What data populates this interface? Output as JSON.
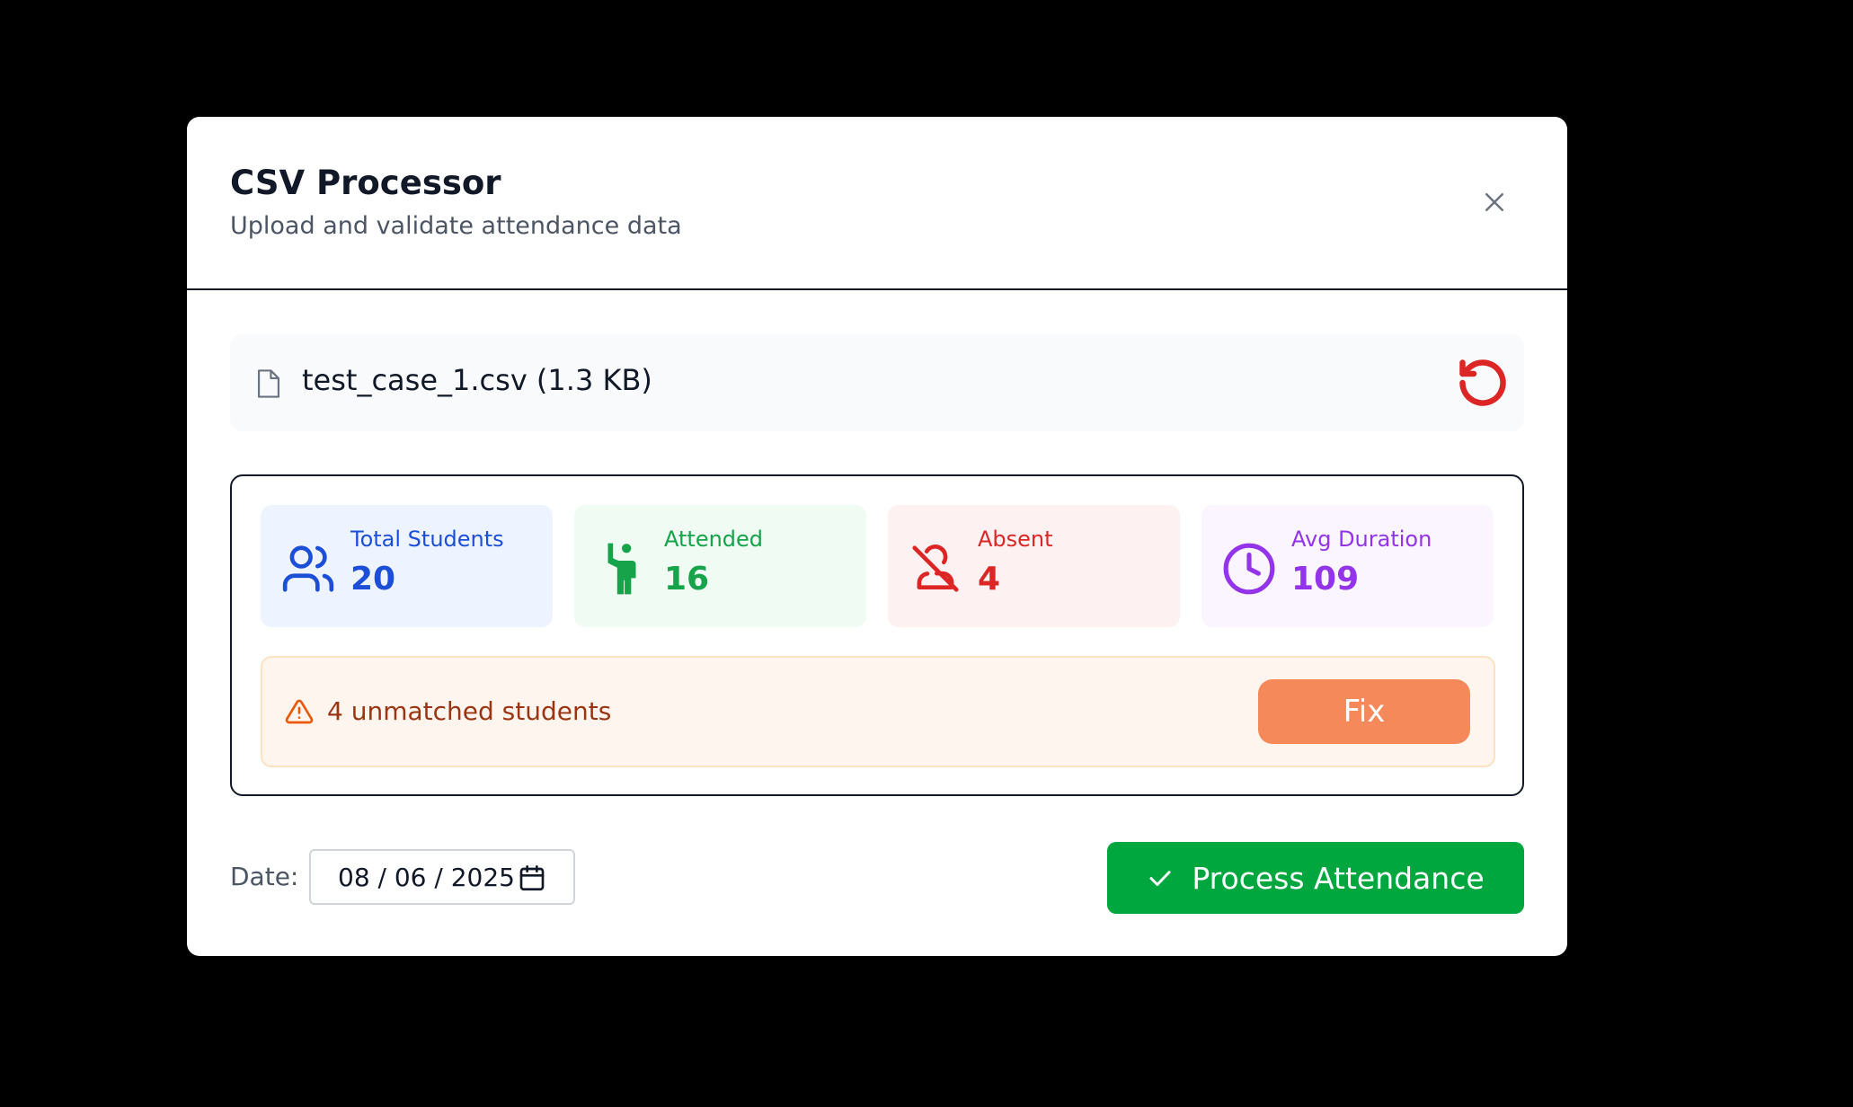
{
  "header": {
    "title": "CSV Processor",
    "subtitle": "Upload and validate attendance data"
  },
  "file": {
    "name": "test_case_1.csv (1.3 KB)"
  },
  "stats": [
    {
      "label": "Total Students",
      "value": "20",
      "icon": "users-icon",
      "color": "#1d4ed8"
    },
    {
      "label": "Attended",
      "value": "16",
      "icon": "person-raised-hand-icon",
      "color": "#16a34a"
    },
    {
      "label": "Absent",
      "value": "4",
      "icon": "user-off-icon",
      "color": "#dc2626"
    },
    {
      "label": "Avg Duration",
      "value": "109",
      "icon": "clock-icon",
      "color": "#9333ea"
    }
  ],
  "warning": {
    "text": "4 unmatched students",
    "fix_label": "Fix",
    "icon": "warning-triangle-icon"
  },
  "date": {
    "label": "Date:",
    "value": "08 / 06 / 2025"
  },
  "actions": {
    "process_label": "Process Attendance"
  },
  "colors": {
    "primary_action": "#00a63e",
    "fix_button": "#f6895a",
    "reset_icon": "#dc2626"
  }
}
